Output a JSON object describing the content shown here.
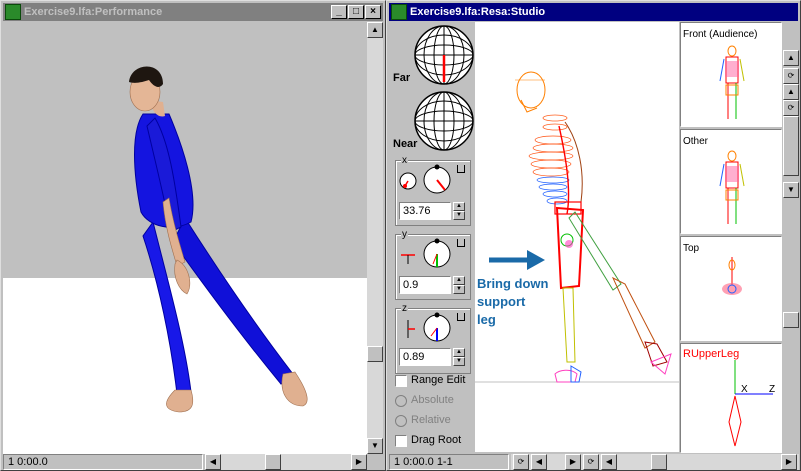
{
  "performance_window": {
    "title": "Exercise9.lfa:Performance",
    "status": "1 0:00.0"
  },
  "studio_window": {
    "title": "Exercise9.lfa:Resa:Studio",
    "status": "1 0:00.0  1-1",
    "view_labels": {
      "far": "Far",
      "near": "Near"
    },
    "axes": [
      {
        "label": "x",
        "value": "33.76"
      },
      {
        "label": "y",
        "value": "0.9"
      },
      {
        "label": "z",
        "value": "0.89"
      }
    ],
    "options": {
      "range_edit": "Range Edit",
      "absolute": "Absolute",
      "relative": "Relative",
      "drag_root": "Drag Root"
    },
    "annotation": [
      "Bring down",
      "support",
      "leg"
    ],
    "thumbnails": [
      {
        "label": "Front (Audience)"
      },
      {
        "label": "Other"
      },
      {
        "label": "Top"
      },
      {
        "label": "RUpperLeg",
        "axis_x": "X",
        "axis_z": "Z"
      }
    ]
  },
  "colors": {
    "active_title": "#000080",
    "inactive_title": "#808080",
    "dancer_body": "#1010e0",
    "skin": "#e0b090",
    "annotation_arrow": "#1a6aa8",
    "highlight_red": "#ff0000"
  }
}
